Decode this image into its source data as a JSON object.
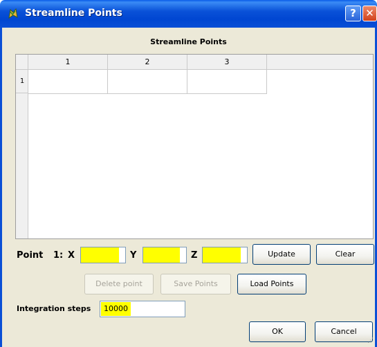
{
  "window": {
    "title": "Streamline Points",
    "help_glyph": "?",
    "close_glyph": "✕",
    "icon": "application-icon"
  },
  "group": {
    "title": "Streamline Points"
  },
  "table": {
    "columns": [
      "1",
      "2",
      "3"
    ],
    "rows": [
      {
        "label": "1",
        "cells": [
          "",
          "",
          ""
        ]
      }
    ]
  },
  "point": {
    "label": "Point",
    "index": "1:",
    "x_label": "X",
    "y_label": "Y",
    "z_label": "Z",
    "x_value": "",
    "y_value": "",
    "z_value": "",
    "highlight_color": "#ffff00"
  },
  "buttons": {
    "update": "Update",
    "clear": "Clear",
    "delete_point": "Delete point",
    "save_points": "Save Points",
    "load_points": "Load Points",
    "ok": "OK",
    "cancel": "Cancel"
  },
  "integration": {
    "label": "Integration steps",
    "value": "10000"
  },
  "colors": {
    "titlebar": "#0a4fd6",
    "dialog_bg": "#ece9d8",
    "field_highlight": "#ffff00"
  }
}
